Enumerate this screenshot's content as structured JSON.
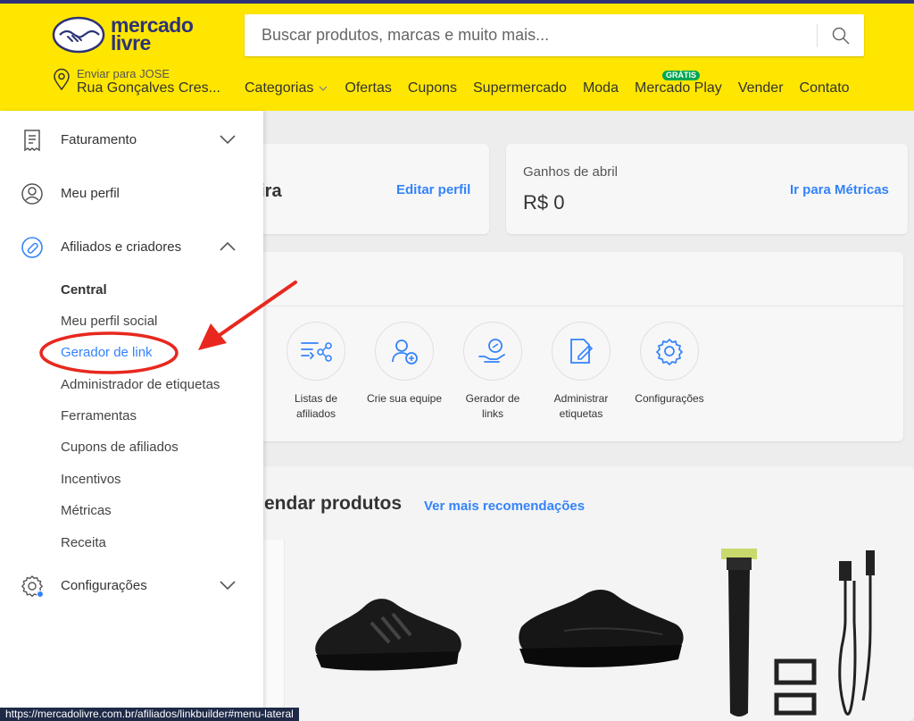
{
  "header": {
    "brand_line1": "mercado",
    "brand_line2": "livre",
    "search_placeholder": "Buscar produtos, marcas e muito mais...",
    "location_small": "Enviar para JOSE",
    "location_big": "Rua Gonçalves Cres...",
    "nav": [
      "Categorias",
      "Ofertas",
      "Cupons",
      "Supermercado",
      "Moda",
      "Mercado Play",
      "Vender",
      "Contato"
    ],
    "badge": "GRÁTIS"
  },
  "main": {
    "profile_name_partial": "eira",
    "edit_profile": "Editar perfil",
    "earnings_label": "Ganhos de abril",
    "earnings_value": "R$ 0",
    "metrics_link": "Ir para Métricas",
    "tools": [
      {
        "line1": "Listas de",
        "line2": "afiliados"
      },
      {
        "line1": "Crie sua equipe",
        "line2": ""
      },
      {
        "line1": "Gerador de",
        "line2": "links"
      },
      {
        "line1": "Administrar",
        "line2": "etiquetas"
      },
      {
        "line1": "Configurações",
        "line2": ""
      }
    ],
    "recommend_title_partial": "endar produtos",
    "recommend_link": "Ver mais recomendações"
  },
  "sidebar": {
    "faturamento": "Faturamento",
    "meu_perfil": "Meu perfil",
    "afiliados": "Afiliados e criadores",
    "subitems": [
      "Central",
      "Meu perfil social",
      "Gerador de link",
      "Administrador de etiquetas",
      "Ferramentas",
      "Cupons de afiliados",
      "Incentivos",
      "Métricas",
      "Receita"
    ],
    "configuracoes": "Configurações"
  },
  "statusbar": "https://mercadolivre.com.br/afiliados/linkbuilder#menu-lateral",
  "colors": {
    "yellow": "#ffe600",
    "blue": "#3483fa",
    "annotation_red": "#e8281e"
  }
}
